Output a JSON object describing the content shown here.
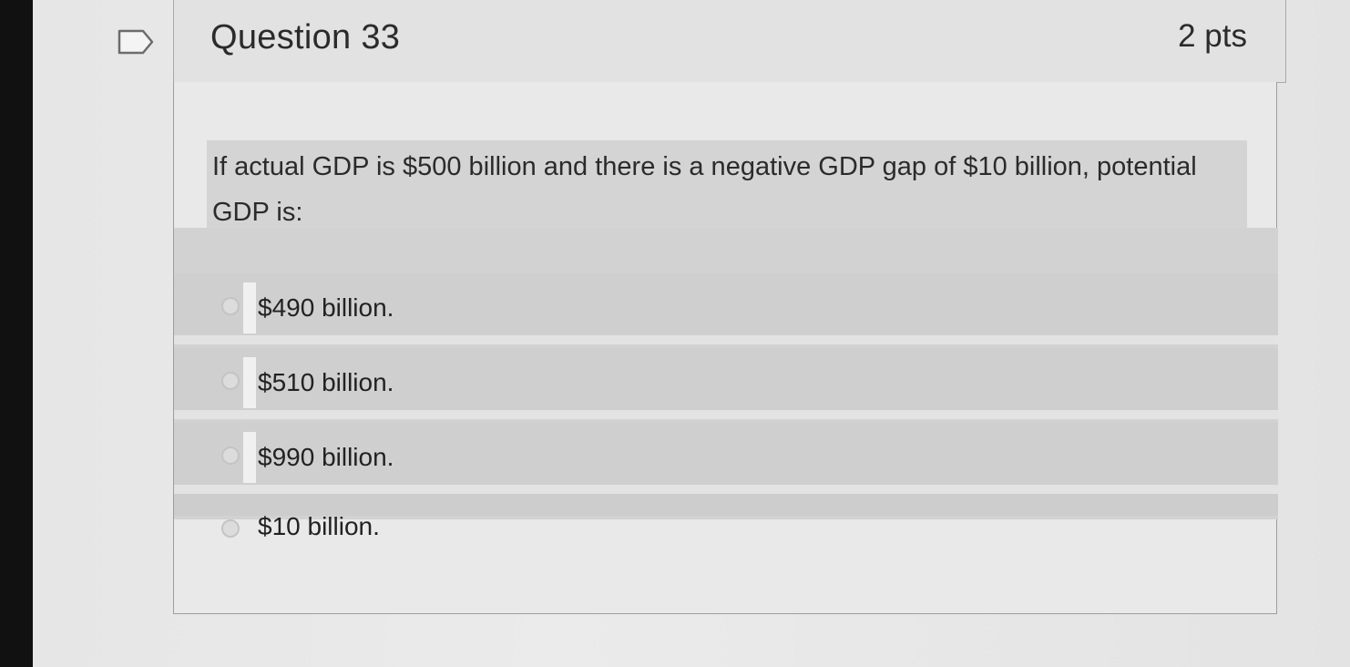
{
  "question": {
    "title": "Question 33",
    "points": "2 pts",
    "text": "If actual GDP is $500 billion and there is a negative GDP gap of $10 billion, potential GDP is:",
    "answers": [
      {
        "label": "$490 billion."
      },
      {
        "label": "$510 billion."
      },
      {
        "label": "$990 billion."
      },
      {
        "label": "$10 billion."
      }
    ]
  },
  "icons": {
    "flag": "flag-outline-icon",
    "radio": "radio-button-icon"
  },
  "colors": {
    "card_border": "#a9a9a9",
    "highlight_band": "#d2d2d2",
    "text": "#2b2b2b"
  }
}
